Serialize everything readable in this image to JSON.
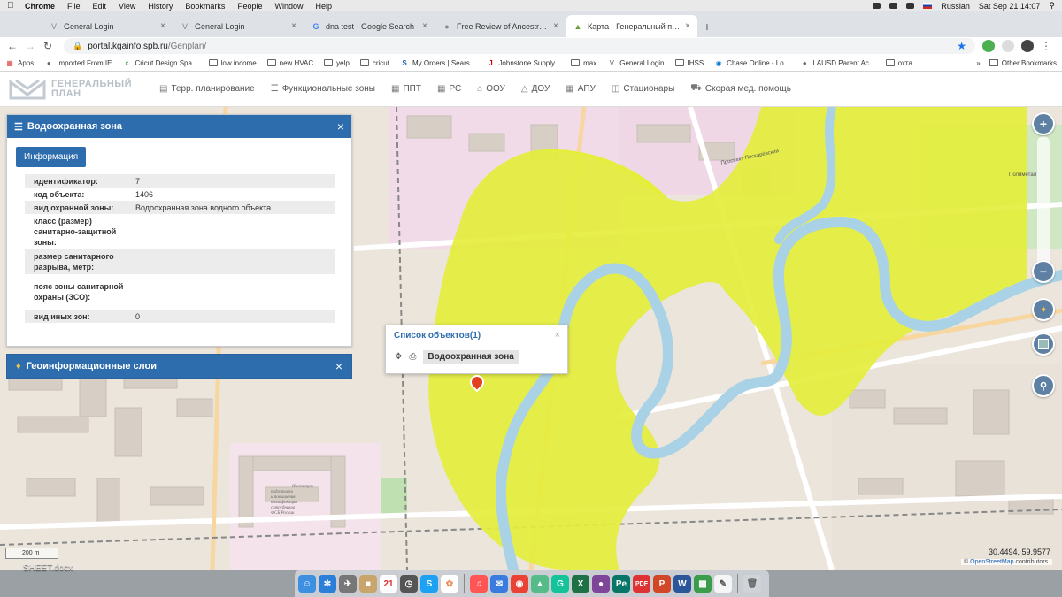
{
  "macbar": {
    "app": "Chrome",
    "menus": [
      "File",
      "Edit",
      "View",
      "History",
      "Bookmarks",
      "People",
      "Window",
      "Help"
    ],
    "lang": "Russian",
    "datetime": "Sat Sep 21  14:07"
  },
  "tabs": [
    {
      "label": "General Login",
      "icon": "v-icon",
      "active": false
    },
    {
      "label": "General Login",
      "icon": "v-icon",
      "active": false
    },
    {
      "label": "dna test - Google Search",
      "icon": "google-icon",
      "active": false
    },
    {
      "label": "Free Review of Ancestry Dna Te",
      "icon": "globe-icon",
      "active": false
    },
    {
      "label": "Карта - Генеральный план Са",
      "icon": "map-icon",
      "active": true
    }
  ],
  "address": {
    "host": "portal.kgainfo.spb.ru",
    "path": "/Genplan/"
  },
  "bookmarks": [
    {
      "label": "Apps",
      "type": "apps"
    },
    {
      "label": "Imported From IE",
      "type": "folder"
    },
    {
      "label": "Cricut Design Spa...",
      "type": "site"
    },
    {
      "label": "low income",
      "type": "folder"
    },
    {
      "label": "new HVAC",
      "type": "folder"
    },
    {
      "label": "yelp",
      "type": "folder"
    },
    {
      "label": "cricut",
      "type": "folder"
    },
    {
      "label": "My Orders | Sears...",
      "type": "site"
    },
    {
      "label": "Johnstone Supply...",
      "type": "site"
    },
    {
      "label": "max",
      "type": "folder"
    },
    {
      "label": "General Login",
      "type": "site"
    },
    {
      "label": "IHSS",
      "type": "folder"
    },
    {
      "label": "Chase Online - Lo...",
      "type": "site"
    },
    {
      "label": "LAUSD Parent Ac...",
      "type": "site"
    },
    {
      "label": "охта",
      "type": "folder"
    }
  ],
  "bookmarks_other": "Other Bookmarks",
  "app": {
    "logo_line1": "ГЕНЕРАЛЬНЫЙ",
    "logo_line2": "ПЛАН",
    "nav": [
      {
        "label": "Терр. планирование",
        "icon": "document-icon"
      },
      {
        "label": "Функциональные зоны",
        "icon": "list-icon"
      },
      {
        "label": "ППТ",
        "icon": "grid-icon"
      },
      {
        "label": "РС",
        "icon": "grid-icon"
      },
      {
        "label": "ООУ",
        "icon": "building-icon"
      },
      {
        "label": "ДОУ",
        "icon": "shirt-icon"
      },
      {
        "label": "АПУ",
        "icon": "grid-icon"
      },
      {
        "label": "Стационары",
        "icon": "hospital-icon"
      },
      {
        "label": "Скорая мед. помощь",
        "icon": "ambulance-icon"
      }
    ]
  },
  "panel": {
    "title": "Водоохранная зона",
    "tab_label": "Информация",
    "rows": [
      {
        "key": "идентификатор:",
        "value": "7"
      },
      {
        "key": "код объекта:",
        "value": "1406"
      },
      {
        "key": "вид охранной зоны:",
        "value": "Водоохранная зона водного объекта"
      },
      {
        "key": "класс (размер) санитарно-защитной зоны:",
        "value": ""
      },
      {
        "key": "размер санитарного разрыва, метр:",
        "value": ""
      },
      {
        "key": "пояс зоны санитарной охраны (ЗСО):",
        "value": ""
      },
      {
        "key": "вид иных зон:",
        "value": "0"
      }
    ]
  },
  "layers_panel": {
    "title": "Геоинформационные слои"
  },
  "popup": {
    "title": "Список объектов(1)",
    "item": "Водоохранная зона"
  },
  "map": {
    "scale_label": "200 m",
    "coords": "30.4494, 59.9577",
    "attribution_prefix": "©",
    "attribution_link": "OpenStreetMap",
    "attribution_suffix": "contributors.",
    "zone_color": "#e4ee3c",
    "river_color": "#a9d2e6",
    "labels": [
      "Проспект Пискарёвский",
      "Институт подготовки и повышения квалификации сотрудников ФСБ России",
      "Полиметал"
    ]
  },
  "desktop_label": "SHEET.docx",
  "colors": {
    "accent": "#2e6dad",
    "control": "#5e80a3"
  }
}
